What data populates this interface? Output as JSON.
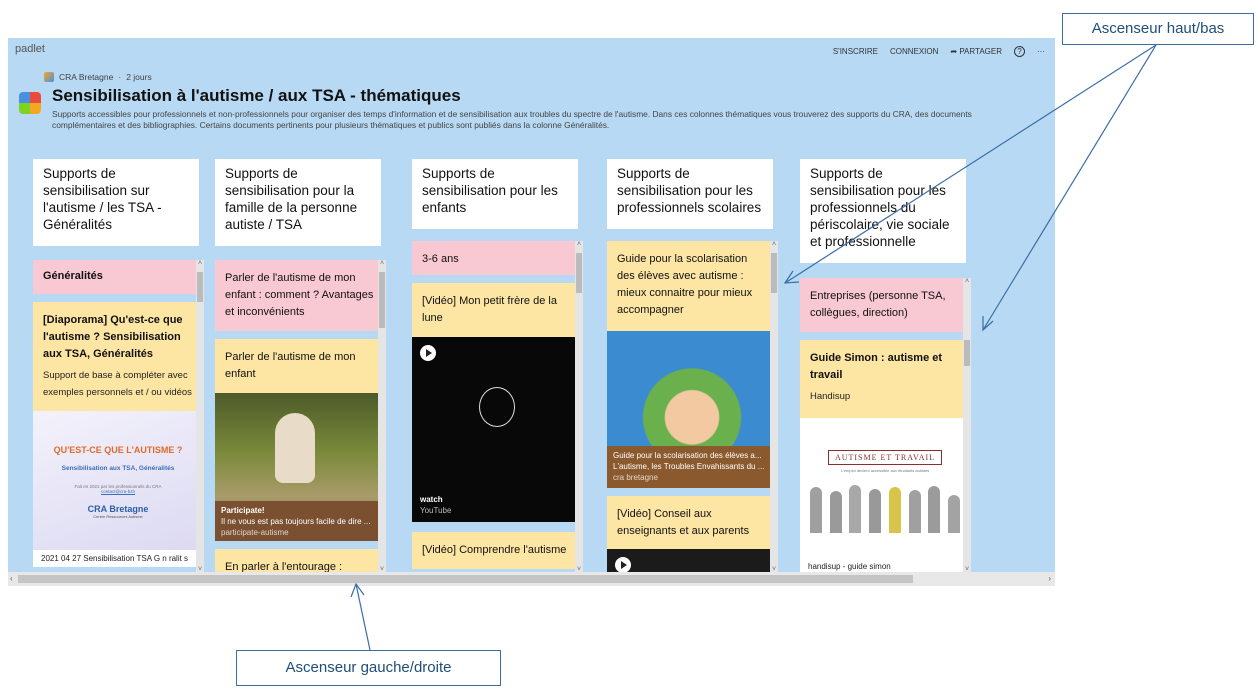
{
  "app": {
    "brand": "padlet",
    "nav": {
      "signup": "S'INSCRIRE",
      "login": "CONNEXION",
      "share": "➦ PARTAGER",
      "help": "?",
      "more": "···"
    },
    "breadcrumb": {
      "author": "CRA Bretagne",
      "sep": "·",
      "time": "2 jours"
    },
    "title": "Sensibilisation à l'autisme / aux TSA - thématiques",
    "description": "Supports accessibles pour professionnels et non-professionnels pour organiser des temps d'information et de sensibilisation aux troubles du spectre de l'autisme. Dans ces colonnes thématiques vous trouverez des supports du CRA, des documents complémentaires et des bibliographies. Certains documents pertinents pour plusieurs thématiques et publics sont publiés dans la colonne Généralités."
  },
  "columns": [
    {
      "head": "Supports de sensibilisation sur l'autisme / les TSA - Généralités",
      "section": "Généralités",
      "card1_title": "[Diaporama] Qu'est-ce que l'autisme ? Sensibilisation aux TSA, Généralités",
      "card1_sub": "Support de base à compléter avec exemples personnels et / ou vidéos",
      "slide_title": "QU'EST-CE QUE L'AUTISME ?",
      "slide_sub": "Sensibilisation aux TSA, Généralités",
      "slide_small": "Fait en 2021 par les professionnels du CRA",
      "slide_link": "contact@cra-bzh",
      "slide_logo": "CRA Bretagne",
      "slide_logo_sub": "Centre Ressources Autisme",
      "file": "2021 04 27 Sensibilisation TSA G n ralit s"
    },
    {
      "head": "Supports de sensibilisation pour la famille de la personne autiste / TSA",
      "card1_title": "Parler de l'autisme de mon enfant : comment ? Avantages et inconvénients",
      "card2_title": "Parler de l'autisme de mon enfant",
      "media_caption_title": "Participate!",
      "media_caption_text": "Il ne vous est pas toujours facile de dire ...",
      "media_caption_src": "participate-autisme",
      "card3_title": "En parler à l'entourage :"
    },
    {
      "head": "Supports de sensibilisation pour les enfants",
      "section": "3-6 ans",
      "card1_title": "[Vidéo] Mon petit frère de la lune",
      "video_label": "watch",
      "video_src": "YouTube",
      "card2_title": "[Vidéo] Comprendre l'autisme"
    },
    {
      "head": "Supports de sensibilisation pour les professionnels scolaires",
      "card1_title": "Guide pour la scolarisation des élèves avec autisme : mieux connaitre pour mieux accompagner",
      "media_caption_title": "Guide pour la scolarisation des élèves a...",
      "media_caption_text": "L'autisme, les Troubles Envahissants du ...",
      "media_caption_src": "cra bretagne",
      "card2_title": "[Vidéo] Conseil aux enseignants et aux parents"
    },
    {
      "head": "Supports de sensibilisation pour les professionnels du périscolaire, vie sociale et professionnelle",
      "section": "Entreprises (personne TSA, collègues, direction)",
      "card1_title": "Guide Simon : autisme et travail",
      "card1_sub": "Handisup",
      "book_title": "AUTISME ET TRAVAIL",
      "book_sub": "L'emploi devient accessible aux étudiants autistes",
      "file": "handisup - guide simon"
    }
  ],
  "annotations": {
    "vertical": "Ascenseur haut/bas",
    "horizontal": "Ascenseur gauche/droite"
  },
  "colors": {
    "board_bg": "#b7d9f3",
    "pink": "#f8c9d3",
    "yellow": "#fde5a4",
    "annotation": "#3a6ea5"
  }
}
